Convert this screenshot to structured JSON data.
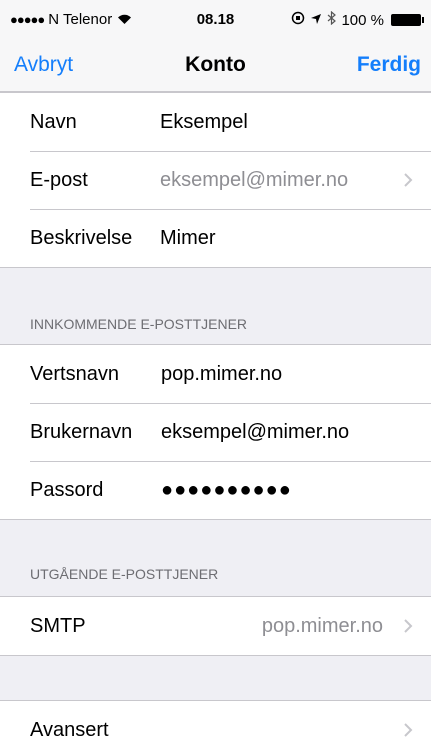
{
  "status": {
    "signal": "●●●●●",
    "carrier": "N Telenor",
    "time": "08.18",
    "battery": "100 %"
  },
  "nav": {
    "cancel": "Avbryt",
    "title": "Konto",
    "done": "Ferdig"
  },
  "account": {
    "name_label": "Navn",
    "name_value": "Eksempel",
    "email_label": "E-post",
    "email_value": "eksempel@mimer.no",
    "desc_label": "Beskrivelse",
    "desc_value": "Mimer"
  },
  "incoming": {
    "header": "INNKOMMENDE E-POSTTJENER",
    "host_label": "Vertsnavn",
    "host_value": "pop.mimer.no",
    "user_label": "Brukernavn",
    "user_value": "eksempel@mimer.no",
    "pass_label": "Passord",
    "pass_value": "●●●●●●●●●●"
  },
  "outgoing": {
    "header": "UTGÅENDE E-POSTTJENER",
    "smtp_label": "SMTP",
    "smtp_value": "pop.mimer.no"
  },
  "advanced": {
    "label": "Avansert"
  }
}
